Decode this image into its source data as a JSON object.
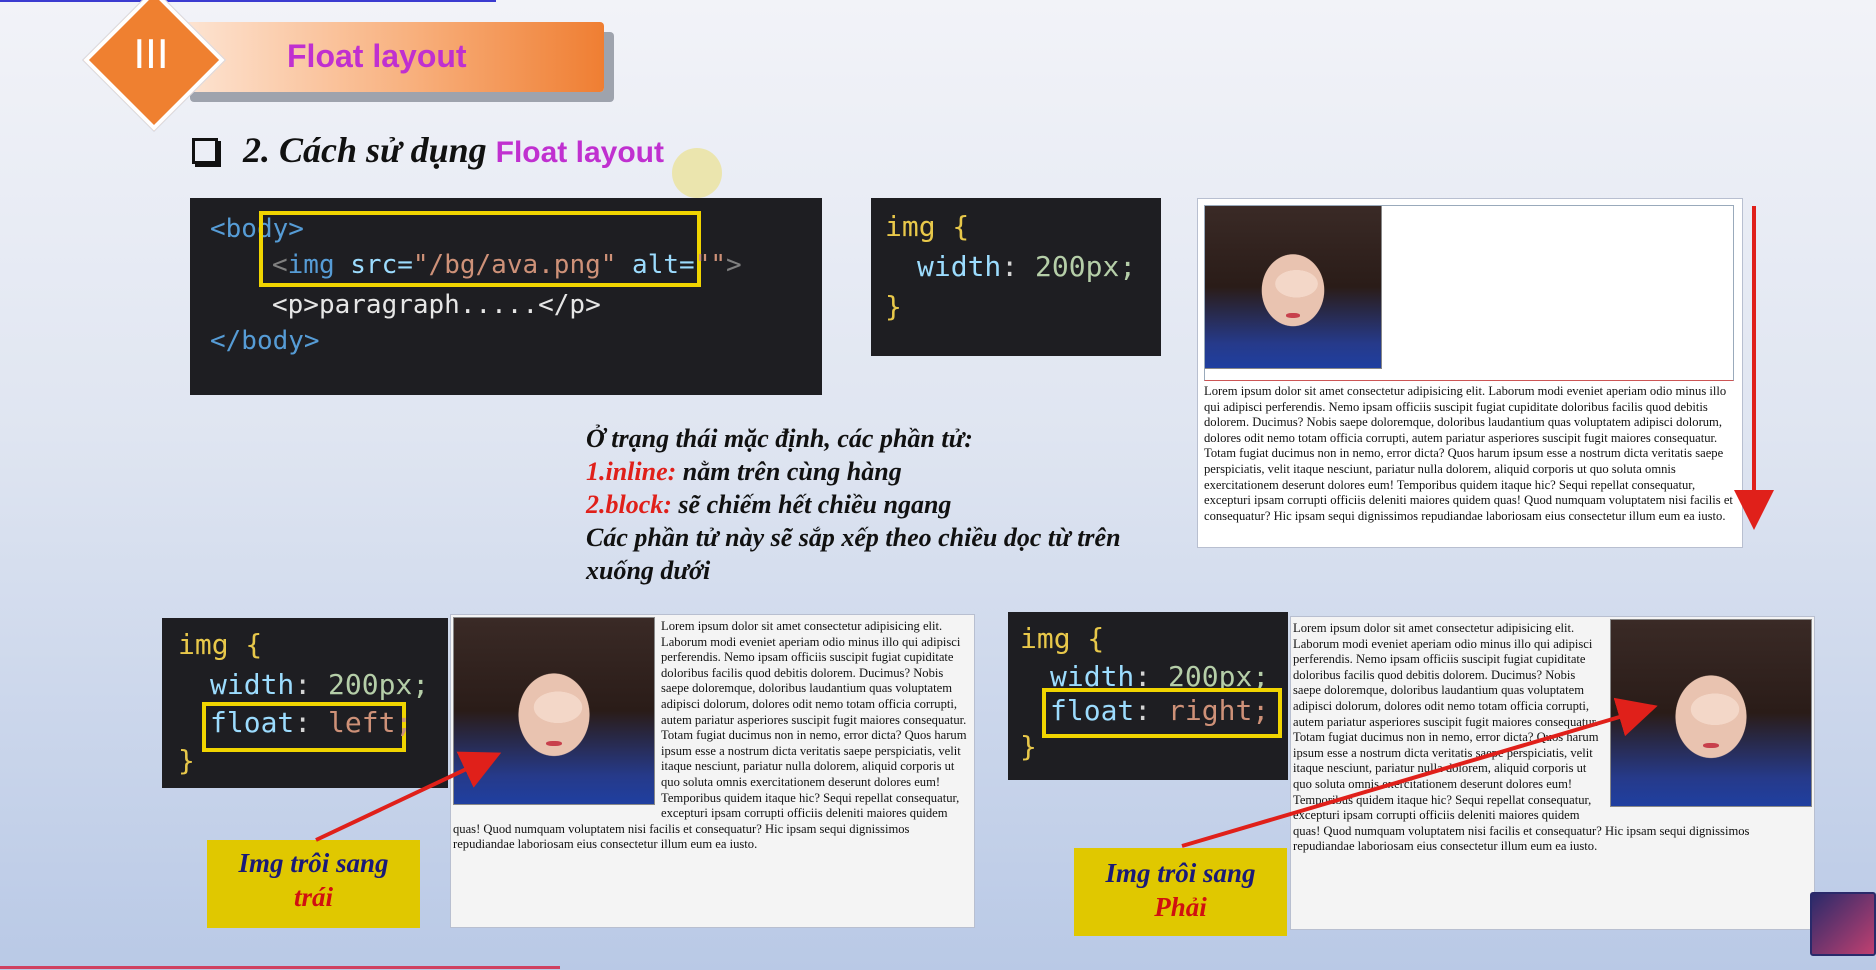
{
  "header": {
    "roman_numeral": "III",
    "title": "Float layout"
  },
  "subtitle": {
    "prefix": "2. Cách sử dụng ",
    "highlight": "Float layout"
  },
  "code_html": {
    "body_open": "<body>",
    "img_open": "<",
    "img_tag": "img",
    "img_src_attr": " src=",
    "img_src_value": "\"/bg/ava.png\"",
    "img_alt_attr": " alt=",
    "img_alt_value": "\"\"",
    "img_close": ">",
    "p_line": "<p>paragraph.....</p>",
    "body_close": "</body>"
  },
  "code_css_default": {
    "selector": "img {",
    "prop": "width",
    "value": "200px;",
    "close": "}"
  },
  "code_css_left": {
    "selector": "img {",
    "width_prop": "width",
    "width_value": "200px;",
    "float_prop": "float",
    "float_value": "left;",
    "close": "}"
  },
  "code_css_right": {
    "selector": "img {",
    "width_prop": "width",
    "width_value": "200px;",
    "float_prop": "float",
    "float_value": "right;",
    "close": "}"
  },
  "description": {
    "line1": "Ở trạng thái mặc định, các phần tử:",
    "inline_label": "1.inline:",
    "inline_text": " nằm trên cùng hàng",
    "block_label": "2.block:",
    "block_text": " sẽ chiếm hết chiều ngang",
    "line4": "Các phần tử này sẽ sắp xếp theo chiều dọc từ trên xuống dưới"
  },
  "lorem": "Lorem ipsum dolor sit amet consectetur adipisicing elit. Laborum modi eveniet aperiam odio minus illo qui adipisci perferendis. Nemo ipsam officiis suscipit fugiat cupiditate doloribus facilis quod debitis dolorem. Ducimus? Nobis saepe doloremque, doloribus laudantium quas voluptatem adipisci dolorum, dolores odit nemo totam officia corrupti, autem pariatur asperiores suscipit fugit maiores consequatur. Totam fugiat ducimus non in nemo, error dicta? Quos harum ipsum esse a nostrum dicta veritatis saepe perspiciatis, velit itaque nesciunt, pariatur nulla dolorem, aliquid corporis ut quo soluta omnis exercitationem deserunt dolores eum! Temporibus quidem itaque hic? Sequi repellat consequatur, excepturi ipsam corrupti officiis deleniti maiores quidem quas! Quod numquam voluptatem nisi facilis et consequatur? Hic ipsam sequi dignissimos repudiandae laboriosam eius consectetur illum eum ea iusto.",
  "label_left": {
    "line1": "Img trôi sang",
    "line2": "trái"
  },
  "label_right": {
    "line1": "Img trôi sang",
    "line2": "Phải"
  },
  "colors": {
    "accent_orange": "#ef8030",
    "title_magenta": "#c030d0",
    "highlight_yellow": "#f0d400",
    "arrow_red": "#e0201a"
  }
}
